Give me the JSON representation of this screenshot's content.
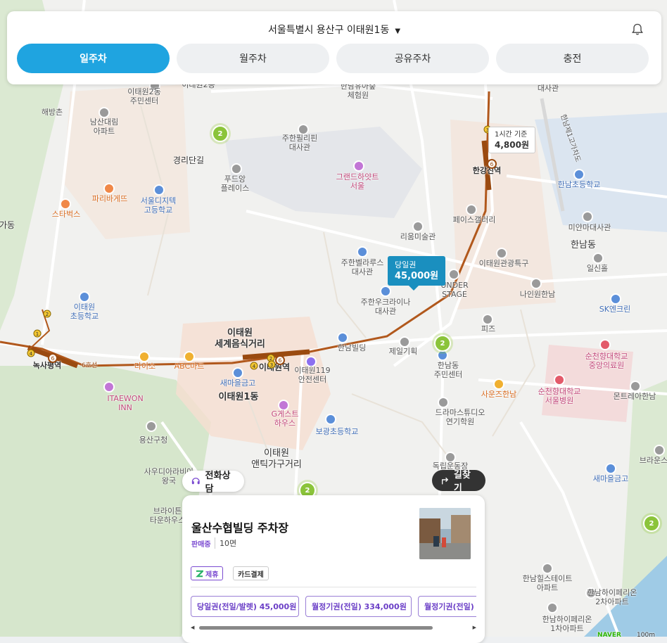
{
  "header": {
    "location": "서울특별시 용산구 이태원1동",
    "caret_icon": "caret-down-icon",
    "bell_icon": "bell-icon"
  },
  "tabs": [
    {
      "label": "일주차",
      "active": true
    },
    {
      "label": "월주차",
      "active": false
    },
    {
      "label": "공유주차",
      "active": false
    },
    {
      "label": "충전",
      "active": false
    }
  ],
  "map": {
    "labels": {
      "haebangchon": "해방촌",
      "namsan_apt": "남산대림\n아파트",
      "gyeongridan": "경리단길",
      "itaewon2_center": "이태원2동\n주민센터",
      "itaewon2_partial": "이태원2동",
      "kazakh": "주한필리핀\n대사관",
      "grand_hyatt": "그랜드하얏트\n서울",
      "foodplace": "푸드앙\n플레이스",
      "paris": "파리바게뜨",
      "starbucks": "스타벅스",
      "digitech": "서울디지텍\n고등학교",
      "gadong": "가동",
      "itaewon_elem": "이태원\n초등학교",
      "noksapyeong": "녹사평역",
      "line6": "6호선",
      "daiso": "다이소",
      "abc": "ABC마트",
      "itaewon_inn": "ITAEWON\nINN",
      "yongsan_office": "용산구청",
      "itaewon_food": "이태원\n세계음식거리",
      "itaewon_station": "이태원역",
      "saemaul": "새마을금고",
      "fire_center": "이태원119\n안전센터",
      "itaewon1": "이태원1동",
      "guesthouse": "G게스트\n하우스",
      "bogwang_elem": "보광초등학교",
      "antique": "이태원\n앤틱가구거리",
      "hannam_bldg": "한남빌딩",
      "jeil": "제일기획",
      "hannam_center": "한남동\n주민센터",
      "saojeonhannam": "사운즈한남",
      "drama": "드라마스튜디오\n연기학원",
      "dokrip": "독립운동장",
      "belarus": "주한벨라루스\n대사관",
      "uruguay": "주한우크라이나\n대사관",
      "leeum": "리움미술관",
      "peace_gallery": "페이스갤러리",
      "understage": "UNDER\nSTAGE",
      "antique_st": "이태원관광특구",
      "nine_one": "나인원한남",
      "feeds": "피즈",
      "hanganjin": "한강진역",
      "hannam_elem": "한남초등학교",
      "mianmar": "미얀마대사관",
      "hannam_dong": "한남동",
      "ilsin": "일신홀",
      "sk": "SK엔크린",
      "soonchun": "순천향대학교\n중앙의료원",
      "soonchun_hosp": "순천향대학교\n서울병원",
      "monte": "몬트레아한남",
      "brownstone": "브라운스",
      "saemaul2": "새마을금고",
      "hannam_hills": "한남힐스테이트\n아파트",
      "hannam_apt2": "한남하이페리온\n2차아파트",
      "hannam_apt1": "한남하이페리온\n1차아파트",
      "hannam_ro": "한남제1고가차도",
      "embassy_top": "대사관",
      "seoul_forest": "한남유아숲\n체험원",
      "bright": "브라이튼\n타운하우스",
      "sauna": "사우디아라비아\n왕국"
    },
    "clusters": [
      "2",
      "2",
      "2",
      "2"
    ],
    "price_tag": {
      "title": "1시간 기준",
      "price": "4,800원"
    },
    "selected_tag": {
      "title": "당일권",
      "price": "45,000원"
    },
    "station_nums": [
      "2",
      "1",
      "4",
      "6",
      "2",
      "3",
      "4",
      "3",
      "6",
      "6"
    ],
    "scale": "100m",
    "naver": "NAVER"
  },
  "buttons": {
    "call": {
      "label": "전화상담",
      "icon": "headset-icon"
    },
    "route": {
      "label": "길찾기",
      "icon": "turn-arrow-icon"
    }
  },
  "panel": {
    "title": "울산수협빌딩 주차장",
    "status": "판매중",
    "count": "10면",
    "photo": "parking-lot-photo",
    "badges": {
      "partner": "제휴",
      "card": "카드결제"
    },
    "partner_icon": "partner-logo-icon",
    "tickets": [
      "당일권(전일/발렛) 45,000원",
      "월정기권(전일) 334,000원",
      "월정기권(전일) 3"
    ]
  },
  "colors": {
    "accent": "#1fa4e0",
    "purple": "#6b3fc7",
    "cluster": "#8bc43a",
    "selected": "#1a8fbf"
  }
}
